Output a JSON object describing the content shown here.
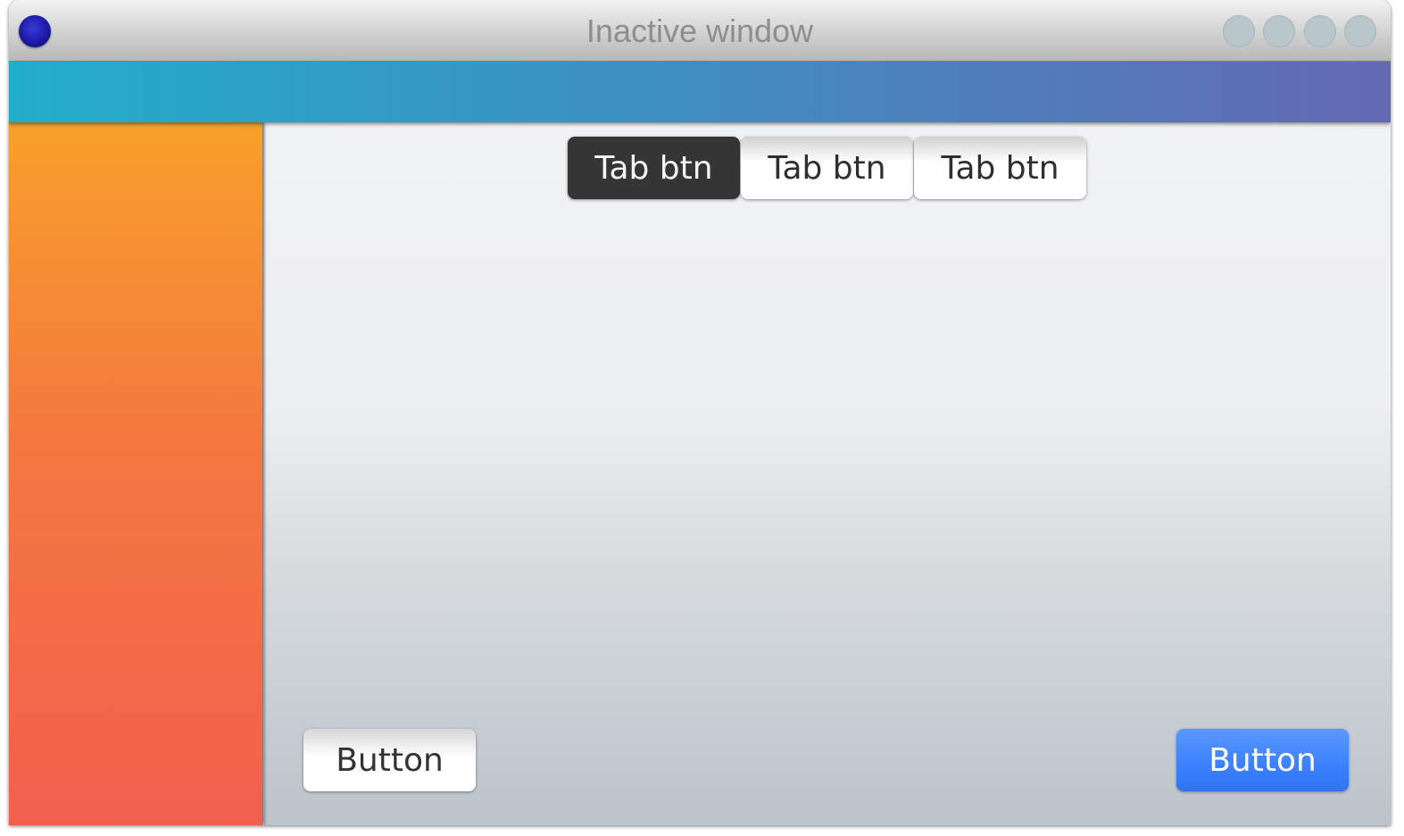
{
  "window": {
    "title": "Inactive window"
  },
  "titlebar": {
    "app_icon": "app-orb-icon",
    "window_buttons": [
      {
        "name": "window-control-1"
      },
      {
        "name": "window-control-2"
      },
      {
        "name": "window-control-3"
      },
      {
        "name": "window-control-4"
      }
    ]
  },
  "tabs": [
    {
      "label": "Tab btn",
      "active": true
    },
    {
      "label": "Tab btn",
      "active": false
    },
    {
      "label": "Tab btn",
      "active": false
    }
  ],
  "buttons": {
    "secondary_label": "Button",
    "primary_label": "Button"
  },
  "colors": {
    "header_gradient_start": "#22adca",
    "header_gradient_end": "#6469b2",
    "sidebar_top": "#f8a02a",
    "sidebar_bottom": "#f25f4f",
    "primary_button": "#3b80ff",
    "active_tab": "#353535"
  }
}
